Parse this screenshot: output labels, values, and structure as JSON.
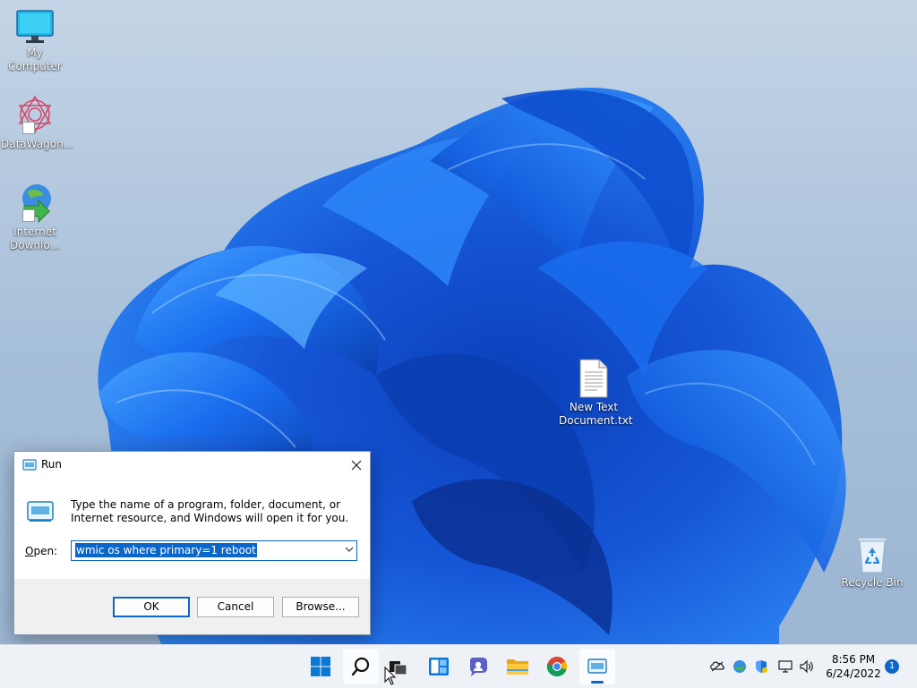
{
  "desktop": {
    "icons": [
      {
        "label": "My Computer",
        "icon": "monitor-icon"
      },
      {
        "label": "DataWagon...",
        "icon": "datawagon-icon"
      },
      {
        "label": "Internet Downlo...",
        "icon": "internet-download-manager-icon"
      },
      {
        "label": "New Text Document.txt",
        "icon": "text-document-icon"
      },
      {
        "label": "Recycle Bin",
        "icon": "recycle-bin-icon"
      }
    ]
  },
  "run_dialog": {
    "title": "Run",
    "description": "Type the name of a program, folder, document, or Internet resource, and Windows will open it for you.",
    "open_label_prefix": "",
    "open_label_underline": "O",
    "open_label_rest": "pen:",
    "open_value": "wmic os where primary=1 reboot",
    "ok_label": "OK",
    "cancel_label": "Cancel",
    "browse_label": "Browse..."
  },
  "taskbar": {
    "apps": [
      {
        "name": "start",
        "icon": "windows-logo-icon"
      },
      {
        "name": "search",
        "icon": "search-icon"
      },
      {
        "name": "task-view",
        "icon": "task-view-icon"
      },
      {
        "name": "widgets",
        "icon": "widgets-icon"
      },
      {
        "name": "chat",
        "icon": "teams-chat-icon"
      },
      {
        "name": "file-explorer",
        "icon": "folder-icon"
      },
      {
        "name": "chrome",
        "icon": "chrome-icon"
      },
      {
        "name": "run",
        "icon": "run-icon"
      }
    ],
    "tray": [
      "network-disconnected-icon",
      "app-tray-icon",
      "security-shield-icon",
      "display-icon",
      "volume-icon"
    ],
    "time": "8:56 PM",
    "date": "6/24/2022",
    "notification_count": "1"
  },
  "colors": {
    "accent": "#0a66c8",
    "wallpaper_blue": "#1a6ff0",
    "taskbar_bg": "#eef2f7"
  }
}
